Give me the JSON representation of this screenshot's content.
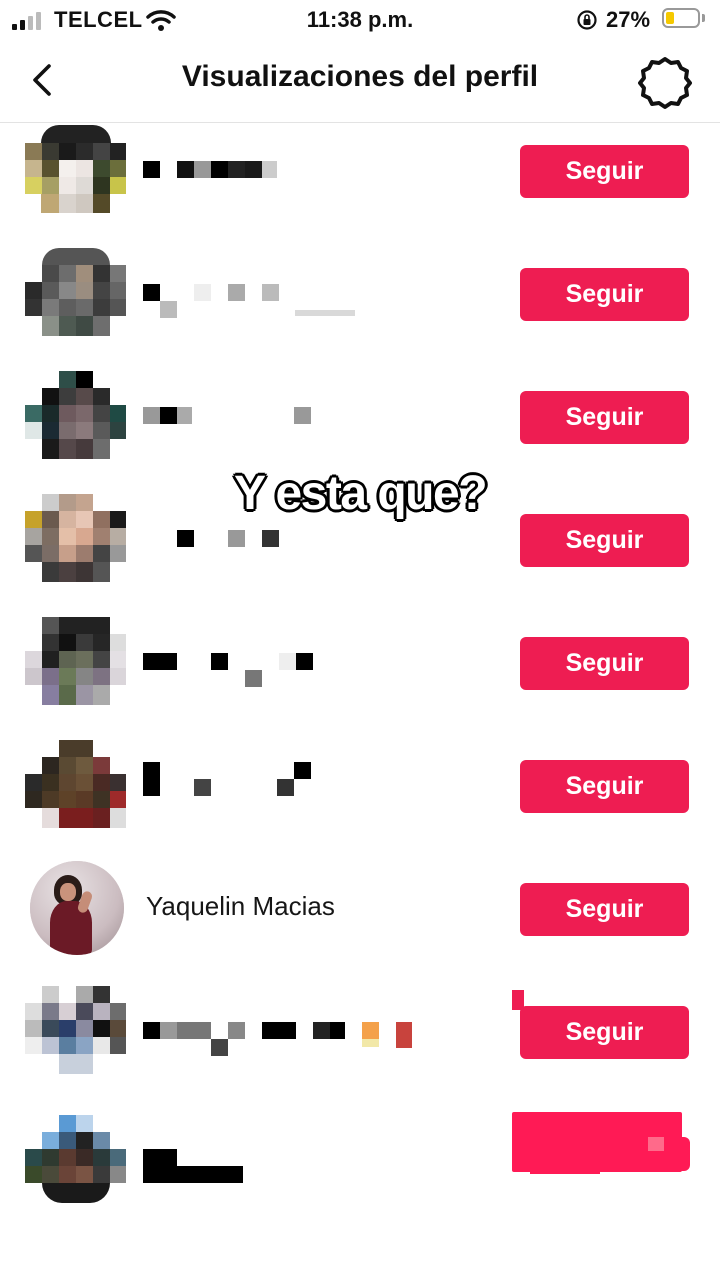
{
  "status_bar": {
    "carrier": "TELCEL",
    "time": "11:38 p.m.",
    "battery_percent": "27%",
    "battery_level": 0.27,
    "battery_color": "#f5c900"
  },
  "header": {
    "title": "Visualizaciones del perfil",
    "back_icon": "chevron-left-icon",
    "settings_icon": "gear-icon"
  },
  "caption": "Y esta que?",
  "follow_label": "Seguir",
  "accent_color": "#ee1d52",
  "rows": [
    {
      "name": "",
      "censored": true
    },
    {
      "name": "",
      "censored": true
    },
    {
      "name": "",
      "censored": true
    },
    {
      "name": "",
      "censored": true
    },
    {
      "name": "",
      "censored": true
    },
    {
      "name": "",
      "censored": true
    },
    {
      "name": "Yaquelin Macias",
      "censored": false
    },
    {
      "name": "",
      "censored": true
    },
    {
      "name": "",
      "censored": true
    }
  ]
}
